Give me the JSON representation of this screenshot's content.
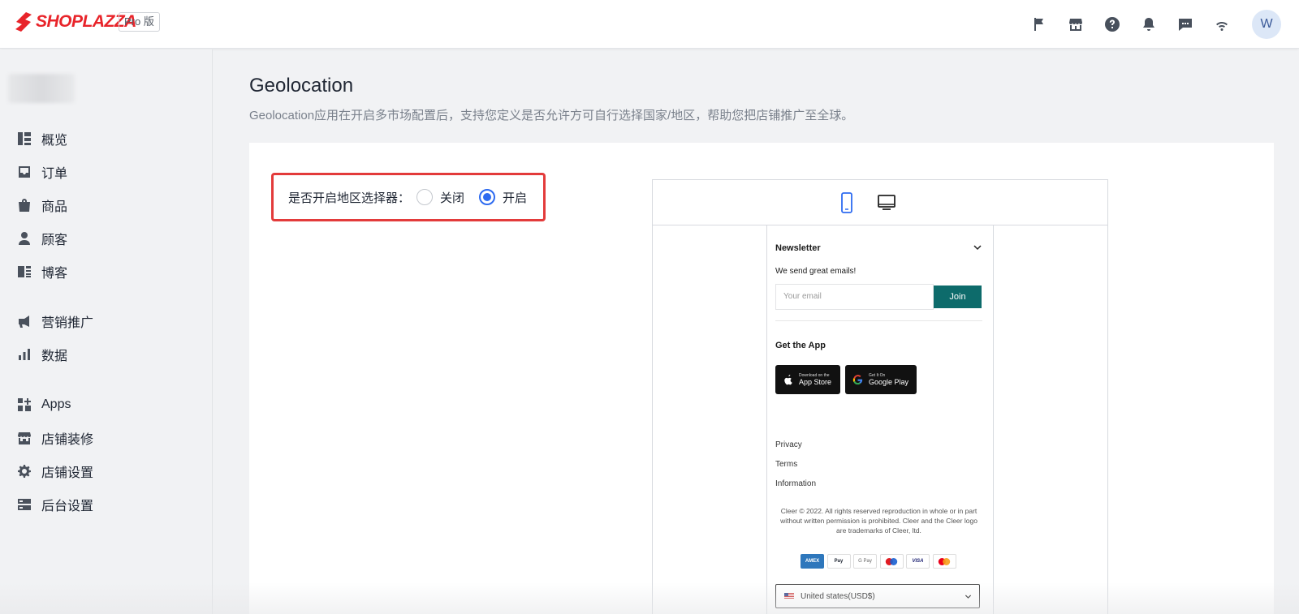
{
  "header": {
    "brand": "SHOPLAZZA",
    "plan_badge": "Pro 版",
    "icons": [
      "flag-icon",
      "store-icon",
      "help-icon",
      "bell-icon",
      "chat-icon",
      "wifi-icon"
    ],
    "avatar_initial": "W",
    "brand_color": "#e8242a"
  },
  "sidebar": {
    "items": [
      {
        "label": "概览",
        "icon": "dashboard-icon"
      },
      {
        "label": "订单",
        "icon": "inbox-icon"
      },
      {
        "label": "商品",
        "icon": "bag-icon"
      },
      {
        "label": "顾客",
        "icon": "person-icon"
      },
      {
        "label": "博客",
        "icon": "blog-icon"
      },
      {
        "label": "营销推广",
        "icon": "megaphone-icon"
      },
      {
        "label": "数据",
        "icon": "bar-chart-icon"
      },
      {
        "label": "Apps",
        "icon": "apps-icon"
      },
      {
        "label": "店铺装修",
        "icon": "storefront-icon"
      },
      {
        "label": "店铺设置",
        "icon": "gear-icon"
      },
      {
        "label": "后台设置",
        "icon": "server-icon"
      }
    ]
  },
  "main": {
    "title": "Geolocation",
    "description": "Geolocation应用在开启多市场配置后，支持您定义是否允许方可自行选择国家/地区，帮助您把店铺推广至全球。",
    "setting": {
      "label": "是否开启地区选择器：",
      "options": [
        "关闭",
        "开启"
      ],
      "selected": "开启",
      "highlight_color": "#e33b3b",
      "accent_color": "#2e6bf0"
    }
  },
  "preview": {
    "devices": [
      "mobile-icon",
      "desktop-icon"
    ],
    "active_device": "mobile",
    "newsletter": {
      "title": "Newsletter",
      "subtitle": "We send great emails!",
      "email_placeholder": "Your email",
      "join_label": "Join",
      "join_color": "#0d6b6b"
    },
    "app": {
      "title": "Get the App",
      "app_store_small": "Download on the",
      "app_store_big": "App Store",
      "google_small": "Get It On",
      "google_big": "Google Play"
    },
    "links": [
      "Privacy",
      "Terms",
      "Information"
    ],
    "copyright": "Cleer © 2022. All rights reserved reproduction in whole or in part without written permission is prohibited. Cleer and the Cleer logo are trademarks of Cleer, ltd.",
    "payments": [
      "AMEX",
      "Apple Pay",
      "G Pay",
      "Maestro",
      "VISA",
      "Mastercard"
    ],
    "country": "United states(USD$)"
  }
}
